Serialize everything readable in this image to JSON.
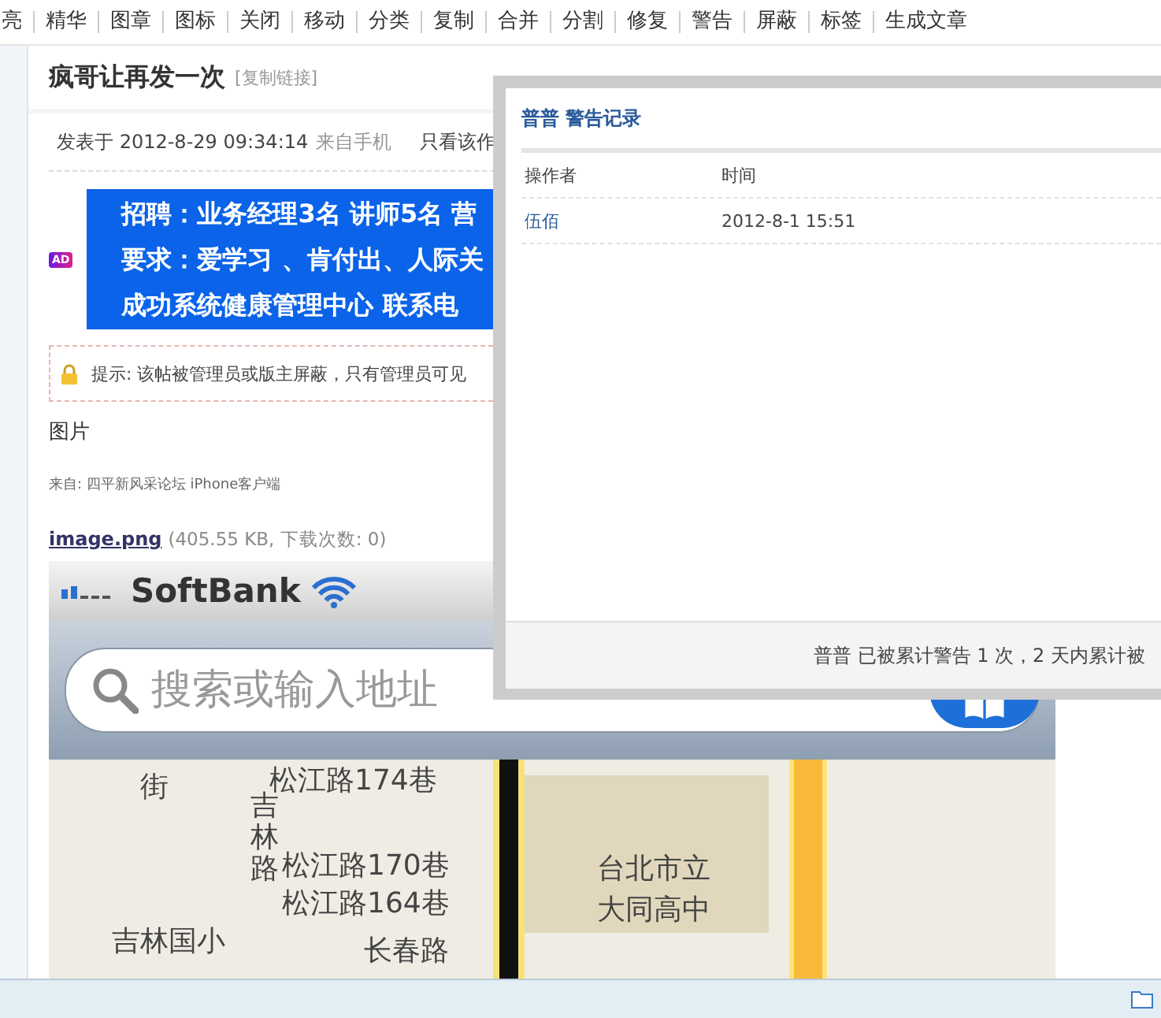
{
  "toolbar": [
    "亮",
    "精华",
    "图章",
    "图标",
    "关闭",
    "移动",
    "分类",
    "复制",
    "合并",
    "分割",
    "修复",
    "警告",
    "屏蔽",
    "标签",
    "生成文章"
  ],
  "post": {
    "title": "疯哥让再发一次",
    "copy_link": "[复制链接]",
    "meta": {
      "posted": "发表于 2012-8-29 09:34:14",
      "source": "来自手机",
      "only_author": "只看该作"
    },
    "ad": {
      "badge": "AD",
      "lines": [
        "招聘：业务经理3名  讲师5名 营",
        "要求：爱学习 、肯付出、人际关",
        "成功系统健康管理中心  联系电"
      ]
    },
    "notice": "提示: 该帖被管理员或版主屏蔽，只有管理员可见",
    "body": "图片",
    "from": "来自: 四平新风采论坛 iPhone客户端",
    "attachment": {
      "name": "image.png",
      "info": "(405.55 KB, 下载次数: 0)"
    },
    "image": {
      "carrier": "SoftBank",
      "search_placeholder": "搜索或输入地址",
      "map_labels": [
        "街",
        "松江路174巷",
        "吉林路",
        "松江路170巷",
        "松江路164巷",
        "台北市立",
        "大同高中",
        "吉林国小",
        "长春路"
      ]
    }
  },
  "dialog": {
    "title": "普普 警告记录",
    "columns": [
      "操作者",
      "时间"
    ],
    "rows": [
      {
        "operator": "伍佰",
        "time": "2012-8-1 15:51"
      }
    ],
    "footer": "普普 已被累计警告 1 次，2 天内累计被"
  }
}
